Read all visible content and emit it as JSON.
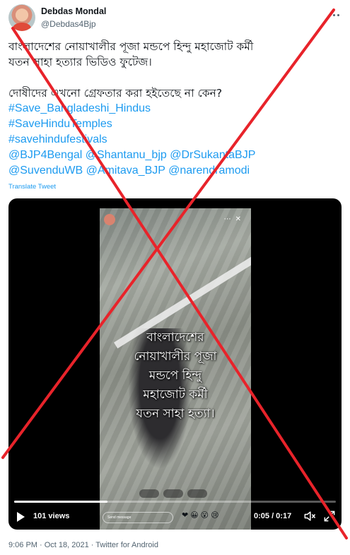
{
  "author": {
    "display_name": "Debdas Mondal",
    "handle": "@Debdas4Bjp"
  },
  "tweet": {
    "lines": [
      "বাংলাদেশের নোয়াখালীর পূজা মন্ডপে হিন্দু মহাজোট কর্মী",
      "যতন সাহা হত্যার ভিডিও ফুটেজ।",
      "দোষীদের এখনো গ্রেফতার করা হইতেছে না কেন?"
    ],
    "hashtags": [
      "#Save_Bangladeshi_Hindus",
      "#SaveHinduTemples",
      "#savehindufestivals"
    ],
    "mentions_line1": [
      "@BJP4Bengal",
      "@Shantanu_bjp",
      "@DrSukantaBJP"
    ],
    "mentions_line2": [
      "@SuvenduWB",
      "@Amitava_BJP",
      "@narendramodi"
    ],
    "translate_label": "Translate Tweet"
  },
  "video": {
    "caption_lines": [
      "বাংলাদেশের",
      "নোয়াখালীর পূজা",
      "মন্ডপে হিন্দু",
      "মহাজোট কর্মী",
      "যতন সাহা হত্যা।"
    ],
    "views": "101 views",
    "time": "0:05 / 0:17",
    "progress_fraction": 0.29,
    "message_placeholder": "Send message"
  },
  "meta": {
    "timestamp": "9:06 PM · Oct 18, 2021 · Twitter for Android"
  },
  "overlay": {
    "cross_color": "#e8232a"
  },
  "icons": [
    "avatar",
    "more-icon",
    "play-icon",
    "volume-icon",
    "fullscreen-icon"
  ]
}
